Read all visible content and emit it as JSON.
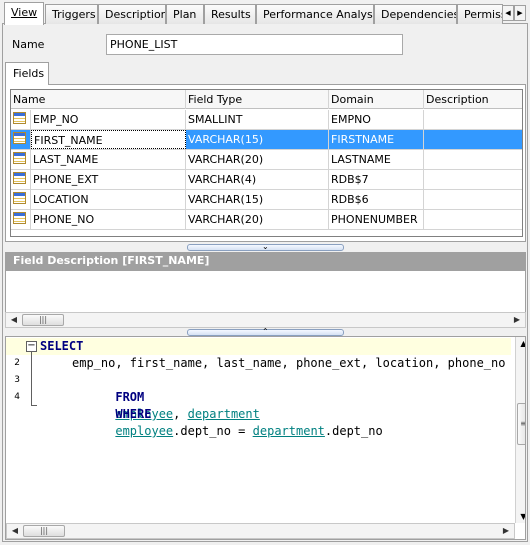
{
  "tabs": [
    {
      "label": "View",
      "active": true
    },
    {
      "label": "Triggers"
    },
    {
      "label": "Description"
    },
    {
      "label": "Plan"
    },
    {
      "label": "Results"
    },
    {
      "label": "Performance Analysis"
    },
    {
      "label": "Dependencies"
    },
    {
      "label": "Permiss"
    }
  ],
  "name_field": {
    "label": "Name",
    "value": "PHONE_LIST"
  },
  "fields_tab": {
    "label": "Fields"
  },
  "fields_grid": {
    "columns": [
      "Name",
      "Field Type",
      "Domain",
      "Description"
    ],
    "rows": [
      {
        "name": "EMP_NO",
        "type": "SMALLINT",
        "domain": "EMPNO",
        "description": ""
      },
      {
        "name": "FIRST_NAME",
        "type": "VARCHAR(15)",
        "domain": "FIRSTNAME",
        "description": "",
        "selected": true
      },
      {
        "name": "LAST_NAME",
        "type": "VARCHAR(20)",
        "domain": "LASTNAME",
        "description": ""
      },
      {
        "name": "PHONE_EXT",
        "type": "VARCHAR(4)",
        "domain": "RDB$7",
        "description": ""
      },
      {
        "name": "LOCATION",
        "type": "VARCHAR(15)",
        "domain": "RDB$6",
        "description": ""
      },
      {
        "name": "PHONE_NO",
        "type": "VARCHAR(20)",
        "domain": "PHONENUMBER",
        "description": ""
      }
    ]
  },
  "field_description": {
    "header": "Field Description [FIRST_NAME]",
    "text": ""
  },
  "sql_editor": {
    "lines": [
      {
        "number": "",
        "collapsed_marker": "−"
      },
      {
        "number": "2"
      },
      {
        "number": "3"
      },
      {
        "number": "4"
      }
    ],
    "tokens": {
      "select": "SELECT",
      "columns": "emp_no, first_name, last_name, phone_ext, location, phone_no",
      "from": "FROM",
      "t_employee": "employee",
      "comma": ", ",
      "t_department": "department",
      "where": "WHERE",
      "cond_left": "employee",
      "cond_left_col": ".dept_no = ",
      "cond_right": "department",
      "cond_right_col": ".dept_no"
    }
  },
  "colors": {
    "selection": "#3399ff",
    "keyword": "#000080",
    "identifier": "#008080",
    "current_line": "#ffffe0"
  },
  "icons": {
    "field_row": "table-field-icon",
    "splitter_down": "chevron-down-icon",
    "splitter_up": "chevron-up-icon"
  }
}
